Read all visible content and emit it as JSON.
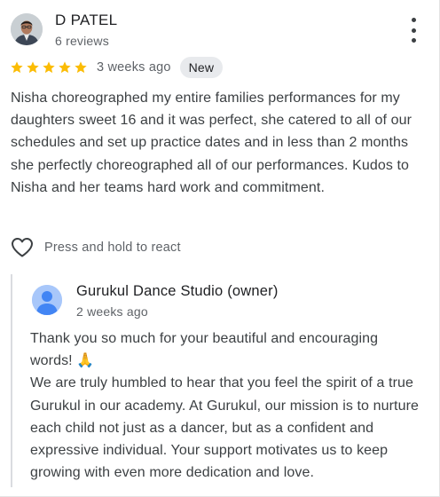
{
  "review": {
    "author": "D PATEL",
    "reviews_count": "6 reviews",
    "rating": 5,
    "time": "3 weeks ago",
    "badge": "New",
    "text": "Nisha choreographed my entire families performances for my daughters sweet 16 and it was perfect, she catered to all of our schedules and set up practice dates and in less than 2 months she perfectly choreographed all of our performances. Kudos to Nisha and her teams hard work and commitment.",
    "react_label": "Press and hold to react",
    "icons": {
      "menu": "more-vert-icon",
      "star": "star-icon",
      "heart": "heart-outline-icon"
    },
    "colors": {
      "star": "#fbbc04",
      "badge_bg": "#e8eaed",
      "owner_avatar": "#a8c7fa",
      "owner_silhouette": "#4285f4"
    }
  },
  "owner_reply": {
    "name": "Gurukul Dance Studio (owner)",
    "time": "2 weeks ago",
    "paragraph_1": "Thank you so much for your beautiful and encouraging words! 🙏",
    "paragraph_2": "We are truly humbled to hear that you feel the spirit of a true Gurukul in our academy. At Gurukul, our mission is to nurture each child not just as a dancer, but as a confident and expressive individual. Your support motivates us to keep growing with even more dedication and love."
  }
}
